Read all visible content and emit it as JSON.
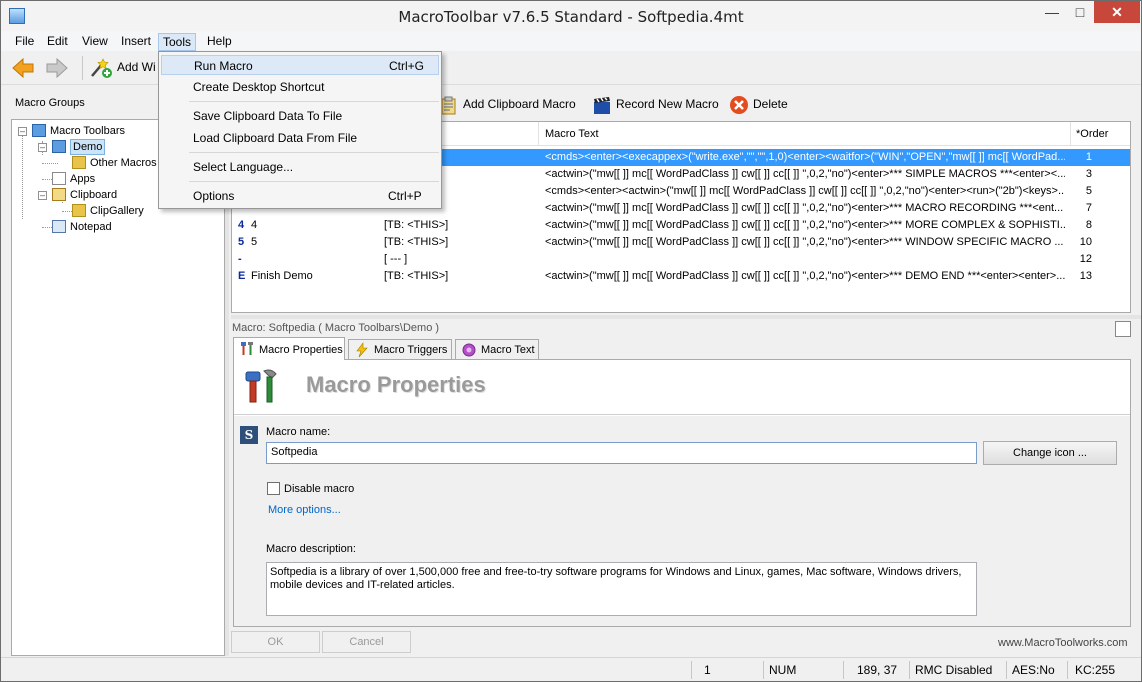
{
  "window": {
    "title": "MacroToolbar v7.6.5 Standard - Softpedia.4mt"
  },
  "menubar": {
    "items": [
      "File",
      "Edit",
      "View",
      "Insert",
      "Tools",
      "Help"
    ]
  },
  "toolbar": {
    "add_wizard_label": "Add Wi"
  },
  "tools_menu": {
    "items": [
      {
        "label": "Run Macro",
        "shortcut": "Ctrl+G"
      },
      {
        "label": "Create Desktop Shortcut",
        "shortcut": ""
      },
      {
        "label": "Save Clipboard Data To File",
        "shortcut": ""
      },
      {
        "label": "Load Clipboard Data From File",
        "shortcut": ""
      },
      {
        "label": "Select Language...",
        "shortcut": ""
      },
      {
        "label": "Options",
        "shortcut": "Ctrl+P"
      }
    ]
  },
  "left_panel": {
    "header": "Macro Groups",
    "tree": [
      "Macro Toolbars",
      "Demo",
      "Other Macros",
      "Apps",
      "Clipboard",
      "ClipGallery",
      "Notepad"
    ]
  },
  "macro_toolbar": {
    "add_clipboard": "Add Clipboard Macro",
    "record_new": "Record New Macro",
    "delete": "Delete"
  },
  "grid": {
    "columns": {
      "text": "Macro Text",
      "order": "*Order"
    },
    "rows": [
      {
        "glyph": "",
        "name": "",
        "toolbar": "]",
        "text": "<cmds><enter><execappex>(\"write.exe\",\"\",\"\",1,0)<enter><waitfor>(\"WIN\",\"OPEN\",\"mw[[ ]] mc[[ WordPad...",
        "order": "1"
      },
      {
        "glyph": "",
        "name": "",
        "toolbar": "]",
        "text": "<actwin>(\"mw[[ ]] mc[[ WordPadClass ]] cw[[ ]] cc[[ ]] \",0,2,\"no\")<enter>*** SIMPLE MACROS ***<enter><...",
        "order": "3"
      },
      {
        "glyph": "",
        "name": "",
        "toolbar": "]",
        "text": "<cmds><enter><actwin>(\"mw[[ ]] mc[[ WordPadClass ]] cw[[ ]] cc[[ ]] \",0,2,\"no\")<enter><run>(\"2b\")<keys>...",
        "order": "5"
      },
      {
        "glyph": "",
        "name": "",
        "toolbar": "",
        "text": "<actwin>(\"mw[[ ]] mc[[ WordPadClass ]] cw[[ ]] cc[[ ]] \",0,2,\"no\")<enter>*** MACRO RECORDING ***<ent...",
        "order": "7"
      },
      {
        "glyph": "4",
        "name": "4",
        "toolbar": "[TB: <THIS>]",
        "text": "<actwin>(\"mw[[ ]] mc[[ WordPadClass ]] cw[[ ]] cc[[ ]] \",0,2,\"no\")<enter>*** MORE COMPLEX & SOPHISTI...",
        "order": "8"
      },
      {
        "glyph": "5",
        "name": "5",
        "toolbar": "[TB: <THIS>]",
        "text": "<actwin>(\"mw[[ ]] mc[[ WordPadClass ]] cw[[ ]] cc[[ ]] \",0,2,\"no\")<enter>*** WINDOW SPECIFIC MACRO ...",
        "order": "10"
      },
      {
        "glyph": "-",
        "name": "",
        "toolbar": "[ --- ]",
        "text": "",
        "order": "12"
      },
      {
        "glyph": "E",
        "name": "Finish Demo",
        "toolbar": "[TB: <THIS>]",
        "text": "<actwin>(\"mw[[ ]] mc[[ WordPadClass ]] cw[[ ]] cc[[ ]] \",0,2,\"no\")<enter>*** DEMO END ***<enter><enter>...",
        "order": "13"
      }
    ]
  },
  "detail": {
    "caption": "Macro: Softpedia ( Macro Toolbars\\Demo )",
    "tabs": [
      "Macro Properties",
      "Macro Triggers",
      "Macro Text"
    ],
    "title": "Macro Properties",
    "name_label": "Macro name:",
    "name_value": "Softpedia",
    "change_icon": "Change icon ...",
    "disable_label": "Disable macro",
    "more_options": "More options...",
    "description_label": "Macro description:",
    "description": "Softpedia is a library of over 1,500,000 free and free-to-try software programs for Windows and Linux, games, Mac software, Windows drivers, mobile devices and IT-related articles.",
    "ok": "OK",
    "cancel": "Cancel",
    "footer_link": "www.MacroToolworks.com"
  },
  "status": {
    "count": "1",
    "num": "NUM",
    "coords": "189, 37",
    "rmc": "RMC Disabled",
    "aes": "AES:No",
    "kc": "KC:255"
  }
}
